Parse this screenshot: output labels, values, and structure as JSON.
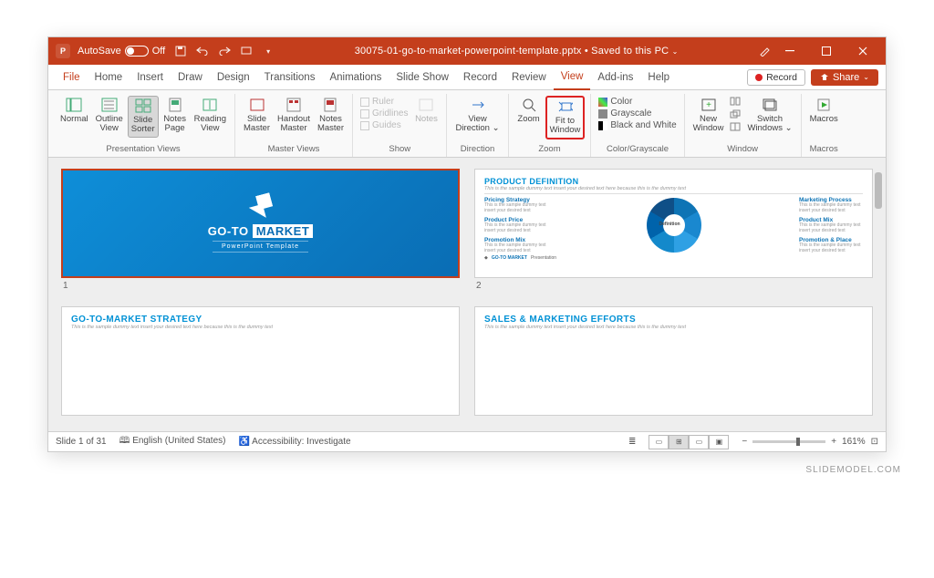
{
  "titlebar": {
    "autosave_label": "AutoSave",
    "autosave_state": "Off",
    "filename": "30075-01-go-to-market-powerpoint-template.pptx",
    "save_status": "Saved to this PC"
  },
  "tabs": {
    "file": "File",
    "home": "Home",
    "insert": "Insert",
    "draw": "Draw",
    "design": "Design",
    "transitions": "Transitions",
    "animations": "Animations",
    "slideshow": "Slide Show",
    "record": "Record",
    "review": "Review",
    "view": "View",
    "addins": "Add-ins",
    "help": "Help",
    "record_btn": "Record",
    "share_btn": "Share"
  },
  "ribbon": {
    "groups": {
      "presentation_views": "Presentation Views",
      "master_views": "Master Views",
      "show": "Show",
      "direction": "Direction",
      "zoom": "Zoom",
      "color_grayscale": "Color/Grayscale",
      "window": "Window",
      "macros": "Macros"
    },
    "btns": {
      "normal": "Normal",
      "outline_view": "Outline\nView",
      "slide_sorter": "Slide\nSorter",
      "notes_page": "Notes\nPage",
      "reading_view": "Reading\nView",
      "slide_master": "Slide\nMaster",
      "handout_master": "Handout\nMaster",
      "notes_master": "Notes\nMaster",
      "ruler": "Ruler",
      "gridlines": "Gridlines",
      "guides": "Guides",
      "notes": "Notes",
      "view_direction": "View\nDirection",
      "zoom_btn": "Zoom",
      "fit_to_window": "Fit to\nWindow",
      "color": "Color",
      "grayscale": "Grayscale",
      "black_white": "Black and White",
      "new_window": "New\nWindow",
      "switch_windows": "Switch\nWindows",
      "macros_btn": "Macros"
    }
  },
  "slides": {
    "s1_num": "1",
    "s1_title_a": "GO-TO",
    "s1_title_b": "MARKET",
    "s1_sub": "PowerPoint Template",
    "s2_num": "2",
    "s2_h": "PRODUCT DEFINITION",
    "s2_sub": "This is the sample dummy text insert your desired text here because this is the dummy text",
    "s2_center": "Definition",
    "s2_items": {
      "l1_h": "Pricing Strategy",
      "l1_t": "This is the sample dummy text insert your desired text",
      "l2_h": "Product Price",
      "l2_t": "This is the sample dummy text insert your desired text",
      "l3_h": "Promotion Mix",
      "l3_t": "This is the sample dummy text insert your desired text",
      "r1_h": "Marketing Process",
      "r1_t": "This is the sample dummy text insert your desired text",
      "r2_h": "Product Mix",
      "r2_t": "This is the sample dummy text insert your desired text",
      "r3_h": "Promotion & Place",
      "r3_t": "This is the sample dummy text insert your desired text"
    },
    "s2_footer_logo": "GO-TO MARKET",
    "s2_footer_text": "Presentation",
    "s3_h": "GO-TO-MARKET STRATEGY",
    "s3_sub": "This is the sample dummy text insert your desired text here because this is the dummy text",
    "s4_h": "SALES & MARKETING EFFORTS",
    "s4_sub": "This is the sample dummy text insert your desired text here because this is the dummy text"
  },
  "status": {
    "slide_of": "Slide 1 of 31",
    "lang": "English (United States)",
    "accessibility": "Accessibility: Investigate",
    "zoom": "161%"
  },
  "watermark": "SLIDEMODEL.COM"
}
